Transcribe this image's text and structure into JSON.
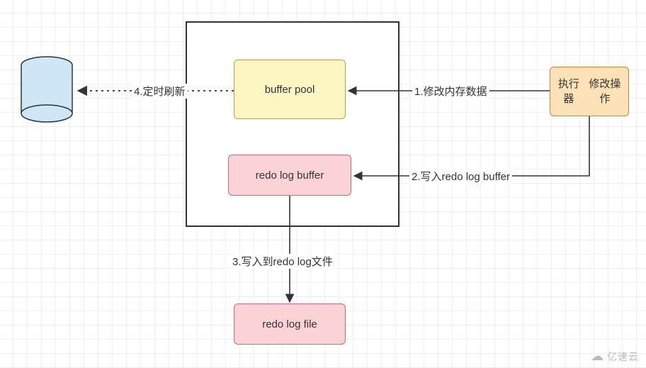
{
  "boxes": {
    "buffer_pool": "buffer pool",
    "redo_log_buffer": "redo log buffer",
    "redo_log_file": "redo log file",
    "executor_line1": "执行器",
    "executor_line2": "修改操作"
  },
  "edges": {
    "e1": "1.修改内存数据",
    "e2": "2.写入redo log buffer",
    "e3": "3.写入到redo log文件",
    "e4": "4.定时刷新"
  },
  "watermark": "亿速云",
  "chart_data": {
    "type": "diagram",
    "title": "",
    "nodes": [
      {
        "id": "database",
        "label": "",
        "kind": "cylinder",
        "fill": "#cfe6f7"
      },
      {
        "id": "engine_container",
        "label": "",
        "kind": "container",
        "fill": "#ffffff"
      },
      {
        "id": "buffer_pool",
        "label": "buffer pool",
        "kind": "box",
        "fill": "#fdf6c2",
        "parent": "engine_container"
      },
      {
        "id": "redo_log_buffer",
        "label": "redo log buffer",
        "kind": "box",
        "fill": "#fbd2d6",
        "parent": "engine_container"
      },
      {
        "id": "redo_log_file",
        "label": "redo log file",
        "kind": "box",
        "fill": "#fbd2d6"
      },
      {
        "id": "executor",
        "label": "执行器\n修改操作",
        "kind": "box",
        "fill": "#fde1b7"
      }
    ],
    "edges": [
      {
        "from": "executor",
        "to": "buffer_pool",
        "label": "1.修改内存数据",
        "style": "solid"
      },
      {
        "from": "executor",
        "to": "redo_log_buffer",
        "label": "2.写入redo log buffer",
        "style": "solid"
      },
      {
        "from": "redo_log_buffer",
        "to": "redo_log_file",
        "label": "3.写入到redo log文件",
        "style": "solid"
      },
      {
        "from": "buffer_pool",
        "to": "database",
        "label": "4.定时刷新",
        "style": "dotted"
      }
    ]
  }
}
